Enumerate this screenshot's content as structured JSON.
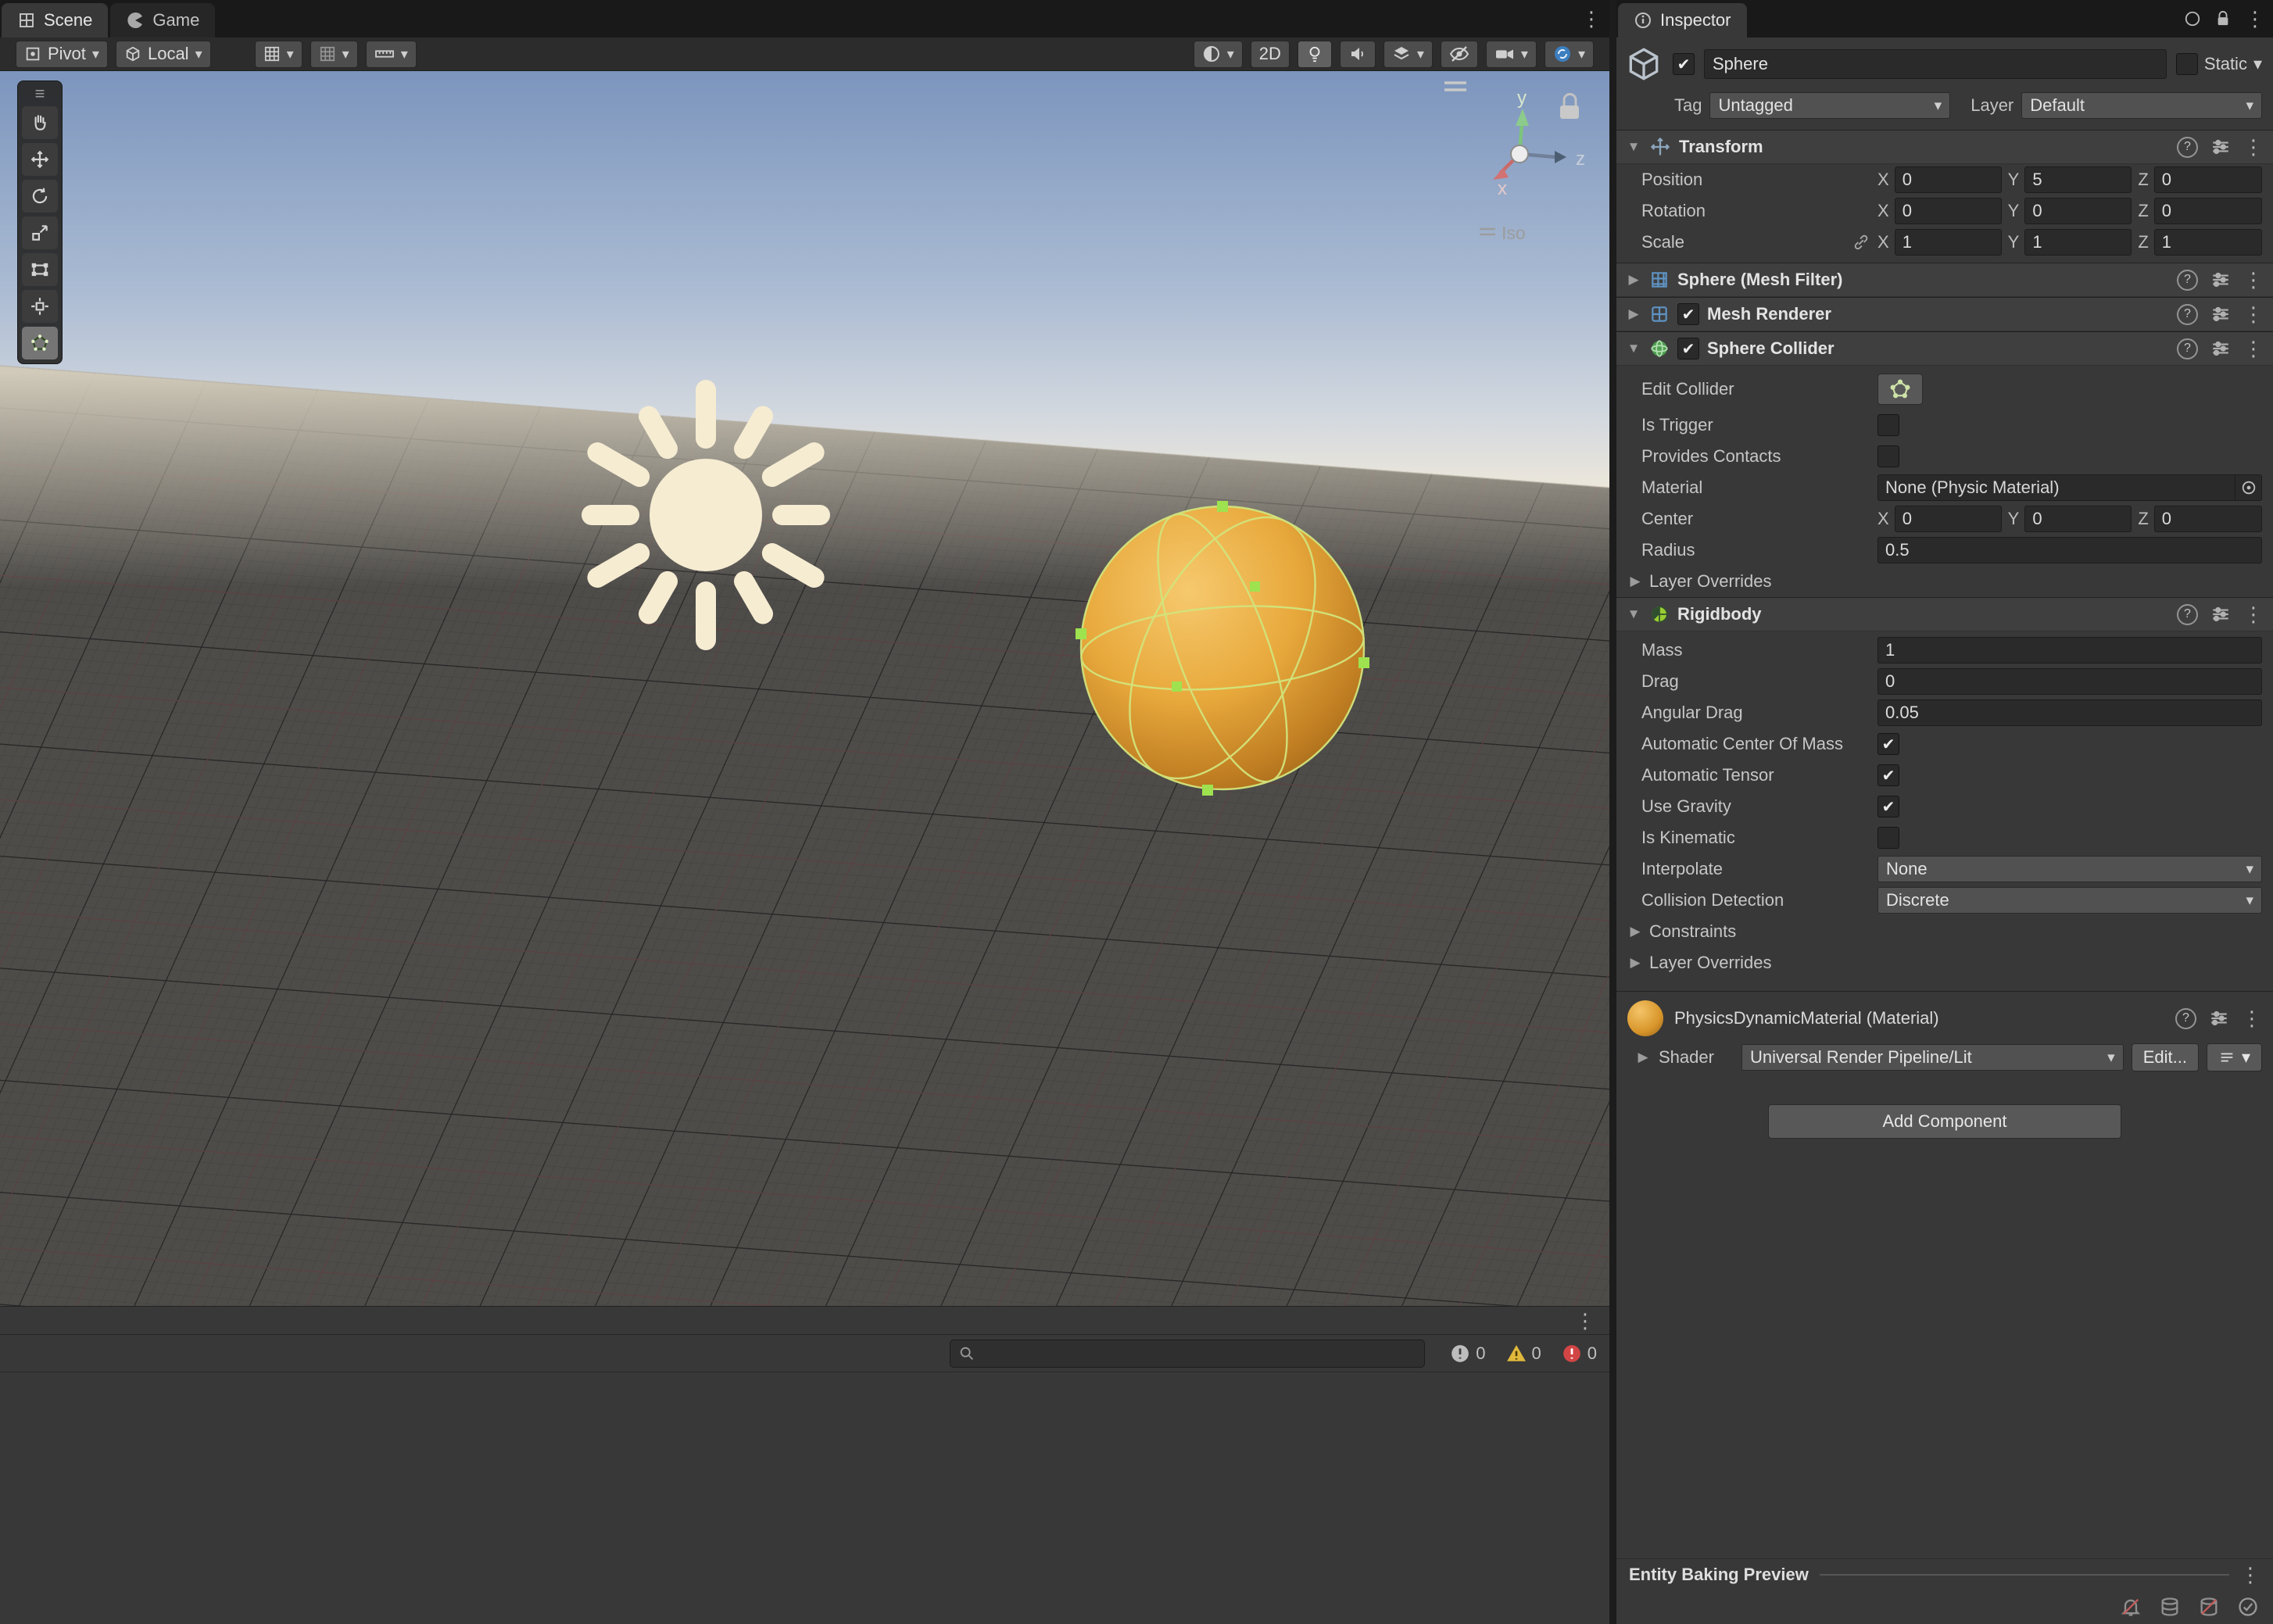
{
  "icons": {
    "check": "✔",
    "caret": "▾",
    "fold_open": "▼",
    "fold_closed": "▶",
    "kebab": "⋮",
    "menu": "≡",
    "help": "?"
  },
  "colors": {
    "accent_blue": "#3c7ebf",
    "sphere_orange": "#e8a33d",
    "collider_green": "#c8dc78",
    "warning_yellow": "#e0b93c",
    "error_red": "#d24545"
  },
  "app": {
    "tabs": {
      "scene": "Scene",
      "game": "Game"
    },
    "toolbar": {
      "pivot": "Pivot",
      "local": "Local",
      "two_d": "2D"
    },
    "scene": {
      "iso": "Iso",
      "axis_x": "x",
      "axis_y": "y",
      "axis_z": "z"
    },
    "console": {
      "info_count": "0",
      "warning_count": "0",
      "error_count": "0"
    }
  },
  "inspector": {
    "tab": "Inspector",
    "header": {
      "name": "Sphere",
      "static": "Static",
      "tag_label": "Tag",
      "tag": "Untagged",
      "layer_label": "Layer",
      "layer": "Default"
    },
    "axis": {
      "x": "X",
      "y": "Y",
      "z": "Z"
    },
    "transform": {
      "title": "Transform",
      "position_label": "Position",
      "rotation_label": "Rotation",
      "scale_label": "Scale",
      "position": {
        "x": "0",
        "y": "5",
        "z": "0"
      },
      "rotation": {
        "x": "0",
        "y": "0",
        "z": "0"
      },
      "scale": {
        "x": "1",
        "y": "1",
        "z": "1"
      }
    },
    "mesh_filter": {
      "title": "Sphere (Mesh Filter)"
    },
    "mesh_renderer": {
      "title": "Mesh Renderer"
    },
    "collider": {
      "title": "Sphere Collider",
      "edit_collider": "Edit Collider",
      "is_trigger": "Is Trigger",
      "provides_contacts": "Provides Contacts",
      "material_label": "Material",
      "material_value": "None (Physic Material)",
      "center_label": "Center",
      "center": {
        "x": "0",
        "y": "0",
        "z": "0"
      },
      "radius_label": "Radius",
      "radius": "0.5",
      "layer_overrides": "Layer Overrides"
    },
    "rigidbody": {
      "title": "Rigidbody",
      "mass_label": "Mass",
      "mass": "1",
      "drag_label": "Drag",
      "drag": "0",
      "angular_drag_label": "Angular Drag",
      "angular_drag": "0.05",
      "auto_com": "Automatic Center Of Mass",
      "auto_tensor": "Automatic Tensor",
      "use_gravity": "Use Gravity",
      "is_kinematic": "Is Kinematic",
      "interpolate_label": "Interpolate",
      "interpolate": "None",
      "collision_label": "Collision Detection",
      "collision": "Discrete",
      "constraints": "Constraints",
      "layer_overrides": "Layer Overrides"
    },
    "material": {
      "title": "PhysicsDynamicMaterial (Material)",
      "shader_label": "Shader",
      "shader": "Universal Render Pipeline/Lit",
      "edit": "Edit..."
    },
    "add_component": "Add Component",
    "entity_baking": "Entity Baking Preview"
  }
}
